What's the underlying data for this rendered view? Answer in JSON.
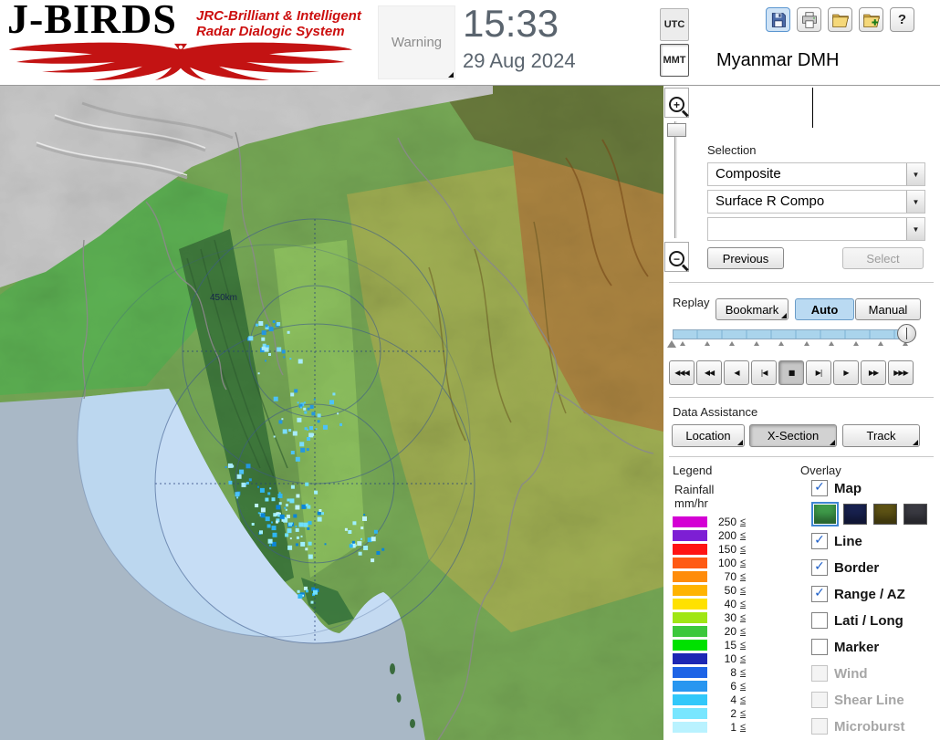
{
  "header": {
    "logo_title": "J-BIRDS",
    "logo_sub1": "JRC-Brilliant & Intelligent",
    "logo_sub2": "Radar  Dialogic  System",
    "warning_label": "Warning",
    "time": "15:33",
    "date": "29 Aug 2024",
    "tz_utc": "UTC",
    "tz_mmt": "MMT",
    "org_name": "Myanmar DMH",
    "help_label": "?"
  },
  "selection": {
    "label": "Selection",
    "dropdown1_value": "Composite",
    "dropdown2_value": "Surface R Compo",
    "dropdown3_value": "",
    "previous_label": "Previous",
    "select_label": "Select"
  },
  "replay": {
    "label": "Replay",
    "bookmark_label": "Bookmark",
    "auto_label": "Auto",
    "manual_label": "Manual",
    "controls": [
      {
        "name": "jump-start-button",
        "glyph": "◀◀◀",
        "pressed": false
      },
      {
        "name": "fast-rewind-button",
        "glyph": "◀◀",
        "pressed": false
      },
      {
        "name": "play-reverse-button",
        "glyph": "◀",
        "pressed": false
      },
      {
        "name": "step-back-button",
        "glyph": "|◀",
        "pressed": false
      },
      {
        "name": "stop-button",
        "glyph": "■",
        "pressed": true
      },
      {
        "name": "step-forward-button",
        "glyph": "▶|",
        "pressed": false
      },
      {
        "name": "play-button",
        "glyph": "▶",
        "pressed": false
      },
      {
        "name": "fast-forward-button",
        "glyph": "▶▶",
        "pressed": false
      },
      {
        "name": "jump-end-button",
        "glyph": "▶▶▶",
        "pressed": false
      }
    ]
  },
  "data_assistance": {
    "label": "Data Assistance",
    "buttons": [
      {
        "name": "location-button",
        "label": "Location",
        "pressed": false
      },
      {
        "name": "x-section-button",
        "label": "X-Section",
        "pressed": true
      },
      {
        "name": "track-button",
        "label": "Track",
        "pressed": false
      }
    ]
  },
  "legend": {
    "label": "Legend",
    "title": "Rainfall",
    "unit": "mm/hr",
    "symbol": "≤",
    "rows": [
      {
        "value": "250",
        "color": "#d400d4"
      },
      {
        "value": "200",
        "color": "#7d1fd4"
      },
      {
        "value": "150",
        "color": "#ff1414"
      },
      {
        "value": "100",
        "color": "#ff5a14"
      },
      {
        "value": "70",
        "color": "#ff8c0a"
      },
      {
        "value": "50",
        "color": "#ffb400"
      },
      {
        "value": "40",
        "color": "#ffe100"
      },
      {
        "value": "30",
        "color": "#a0e614"
      },
      {
        "value": "20",
        "color": "#3cc83c"
      },
      {
        "value": "15",
        "color": "#00e100"
      },
      {
        "value": "10",
        "color": "#1e28b4"
      },
      {
        "value": "8",
        "color": "#1e64e6"
      },
      {
        "value": "6",
        "color": "#2896f0"
      },
      {
        "value": "4",
        "color": "#32c8fa"
      },
      {
        "value": "2",
        "color": "#78e6ff"
      },
      {
        "value": "1",
        "color": "#b9f2ff"
      }
    ]
  },
  "overlay": {
    "label": "Overlay",
    "items": [
      {
        "label": "Map",
        "checked": true,
        "disabled": false
      },
      {
        "label": "Line",
        "checked": true,
        "disabled": false
      },
      {
        "label": "Border",
        "checked": true,
        "disabled": false
      },
      {
        "label": "Range / AZ",
        "checked": true,
        "disabled": false
      },
      {
        "label": "Lati / Long",
        "checked": false,
        "disabled": false
      },
      {
        "label": "Marker",
        "checked": false,
        "disabled": false
      },
      {
        "label": "Wind",
        "checked": false,
        "disabled": true
      },
      {
        "label": "Shear Line",
        "checked": false,
        "disabled": true
      },
      {
        "label": "Microburst",
        "checked": false,
        "disabled": true
      }
    ],
    "map_colors": [
      "#3f9b4a",
      "#18214f",
      "#5d5214",
      "#3a3a42"
    ],
    "selected_map_color": 0
  },
  "map": {
    "range_label": "450km",
    "zoom_in_symbol": "+",
    "zoom_out_symbol": "−"
  }
}
